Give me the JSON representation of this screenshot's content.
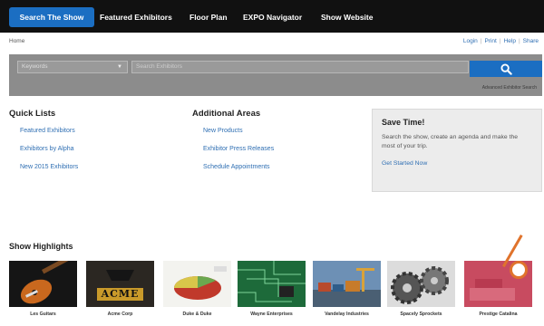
{
  "topnav": {
    "tabs": [
      "Search The Show",
      "Featured Exhibitors",
      "Floor Plan",
      "EXPO Navigator",
      "Show Website"
    ]
  },
  "subbar": {
    "home": "Home",
    "links": [
      "Login",
      "Print",
      "Help",
      "Share"
    ]
  },
  "search": {
    "select_value": "Keywords",
    "placeholder": "Search Exhibitors",
    "advanced": "Advanced Exhibitor Search"
  },
  "quick_lists": {
    "title": "Quick Lists",
    "items": [
      "Featured Exhibitors",
      "Exhibitors by Alpha",
      "New 2015 Exhibitors"
    ]
  },
  "additional_areas": {
    "title": "Additional Areas",
    "items": [
      "New Products",
      "Exhibitor Press Releases",
      "Schedule Appointments"
    ]
  },
  "save_time": {
    "title": "Save Time!",
    "text": "Search the show, create an agenda and make the most of your trip.",
    "cta": "Get Started Now"
  },
  "highlights": {
    "title": "Show Highlights",
    "items": [
      "Les Guitars",
      "Acme Corp",
      "Duke & Duke",
      "Wayne Enterprises",
      "Vandelay Industries",
      "Spacely Sprockets",
      "Prestige Catalina"
    ]
  },
  "acme_logo": "ACME",
  "colors": {
    "nav_bg": "#111111",
    "accent": "#1b6ec2",
    "search_bg": "#8c8c8c",
    "link": "#2f6fb3",
    "pointer": "#e0732c"
  }
}
